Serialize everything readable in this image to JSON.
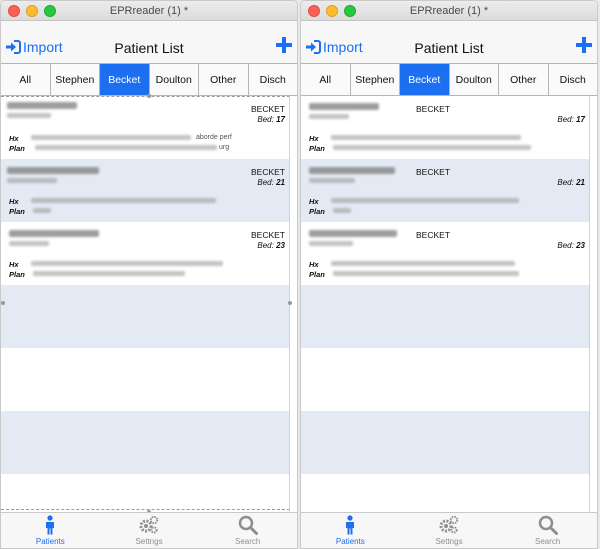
{
  "colors": {
    "accent": "#1d6ff2",
    "alt_row": "#e4eaf4",
    "light_red": "#fd5f57",
    "light_yellow": "#febc2e",
    "light_green": "#28c840"
  },
  "windows": [
    {
      "title": "EPRreader (1) *",
      "nav": {
        "import_label": "Import",
        "title": "Patient List"
      },
      "tabs": [
        {
          "label": "All",
          "active": false
        },
        {
          "label": "Stephen",
          "active": false
        },
        {
          "label": "Becket",
          "active": true
        },
        {
          "label": "Doulton",
          "active": false
        },
        {
          "label": "Other",
          "active": false
        },
        {
          "label": "Disch",
          "active": false
        }
      ],
      "patients": [
        {
          "ward": "BECKET",
          "bed_prefix": "Bed:",
          "bed": "17",
          "hx_label": "Hx",
          "plan_label": "Plan",
          "hx_extra": "aborde perf",
          "plan_extra": "urg"
        },
        {
          "ward": "BECKET",
          "bed_prefix": "Bed:",
          "bed": "21",
          "hx_label": "Hx",
          "plan_label": "Plan"
        },
        {
          "ward": "BECKET",
          "bed_prefix": "Bed:",
          "bed": "23",
          "hx_label": "Hx",
          "plan_label": "Plan"
        }
      ],
      "tabbar": [
        {
          "label": "Patients",
          "icon": "person-icon",
          "active": true
        },
        {
          "label": "Settngs",
          "icon": "gears-icon",
          "active": false
        },
        {
          "label": "Search",
          "icon": "search-icon",
          "active": false
        }
      ]
    },
    {
      "title": "EPRreader (1) *",
      "nav": {
        "import_label": "Import",
        "title": "Patient List"
      },
      "tabs": [
        {
          "label": "All",
          "active": false
        },
        {
          "label": "Stephen",
          "active": false
        },
        {
          "label": "Becket",
          "active": true
        },
        {
          "label": "Doulton",
          "active": false
        },
        {
          "label": "Other",
          "active": false
        },
        {
          "label": "Disch",
          "active": false
        }
      ],
      "patients": [
        {
          "ward": "BECKET",
          "bed_prefix": "Bed:",
          "bed": "17",
          "hx_label": "Hx",
          "plan_label": "Plan"
        },
        {
          "ward": "BECKET",
          "bed_prefix": "Bed:",
          "bed": "21",
          "hx_label": "Hx",
          "plan_label": "Plan"
        },
        {
          "ward": "BECKET",
          "bed_prefix": "Bed:",
          "bed": "23",
          "hx_label": "Hx",
          "plan_label": "Plan"
        }
      ],
      "tabbar": [
        {
          "label": "Patients",
          "icon": "person-icon",
          "active": true
        },
        {
          "label": "Settngs",
          "icon": "gears-icon",
          "active": false
        },
        {
          "label": "Search",
          "icon": "search-icon",
          "active": false
        }
      ]
    }
  ]
}
